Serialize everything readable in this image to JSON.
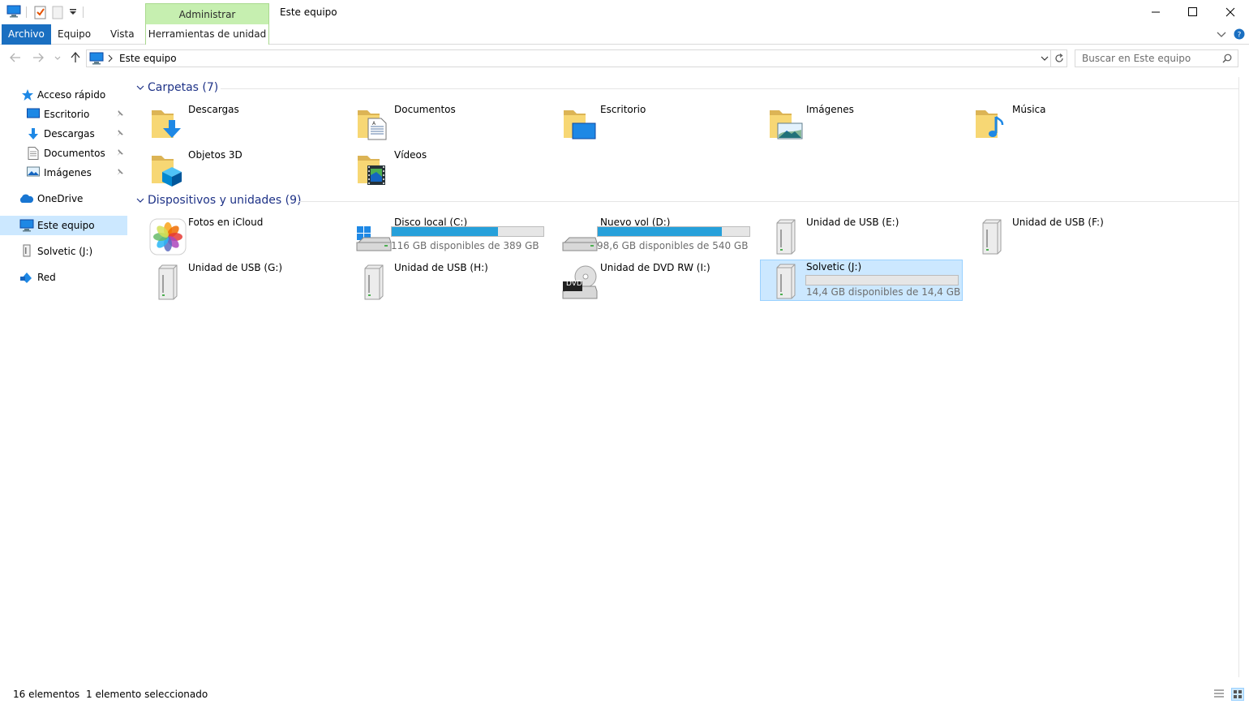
{
  "window": {
    "title": "Este equipo",
    "context_tab_group": "Administrar"
  },
  "ribbon": {
    "tabs": [
      {
        "label": "Archivo"
      },
      {
        "label": "Equipo"
      },
      {
        "label": "Vista"
      },
      {
        "label": "Herramientas de unidad"
      }
    ]
  },
  "address": {
    "path": "Este equipo",
    "search_placeholder": "Buscar en Este equipo"
  },
  "nav": {
    "quick_access": "Acceso rápido",
    "items": [
      {
        "label": "Escritorio",
        "pinned": true
      },
      {
        "label": "Descargas",
        "pinned": true
      },
      {
        "label": "Documentos",
        "pinned": true
      },
      {
        "label": "Imágenes",
        "pinned": true
      }
    ],
    "onedrive": "OneDrive",
    "this_pc": "Este equipo",
    "solvetic": "Solvetic (J:)",
    "network": "Red"
  },
  "folders": {
    "header": "Carpetas (7)",
    "items": [
      {
        "name": "Descargas",
        "icon": "downloads-folder-icon"
      },
      {
        "name": "Documentos",
        "icon": "documents-folder-icon"
      },
      {
        "name": "Escritorio",
        "icon": "desktop-folder-icon"
      },
      {
        "name": "Imágenes",
        "icon": "pictures-folder-icon"
      },
      {
        "name": "Música",
        "icon": "music-folder-icon"
      },
      {
        "name": "Objetos 3D",
        "icon": "3d-objects-folder-icon"
      },
      {
        "name": "Vídeos",
        "icon": "videos-folder-icon"
      }
    ]
  },
  "devices": {
    "header": "Dispositivos y unidades (9)",
    "items": [
      {
        "name": "Fotos en iCloud",
        "icon": "icloud-photos-icon"
      },
      {
        "name": "Disco local (C:)",
        "free": "116 GB disponibles de 389 GB",
        "used_fraction": 0.7,
        "icon": "windows-drive-icon"
      },
      {
        "name": "Nuevo vol (D:)",
        "free": "98,6 GB disponibles de 540 GB",
        "used_fraction": 0.82,
        "icon": "hard-drive-icon"
      },
      {
        "name": "Unidad de USB (E:)",
        "icon": "usb-drive-icon"
      },
      {
        "name": "Unidad de USB (F:)",
        "icon": "usb-drive-icon"
      },
      {
        "name": "Unidad de USB (G:)",
        "icon": "usb-drive-icon"
      },
      {
        "name": "Unidad de USB (H:)",
        "icon": "usb-drive-icon"
      },
      {
        "name": "Unidad de DVD RW (I:)",
        "icon": "dvd-drive-icon",
        "badge": "DVD"
      },
      {
        "name": "Solvetic (J:)",
        "free": "14,4 GB disponibles de 14,4 GB",
        "used_fraction": 0.0,
        "icon": "usb-drive-icon",
        "selected": true
      }
    ]
  },
  "status": {
    "count": "16 elementos",
    "selection": "1 elemento seleccionado"
  },
  "colors": {
    "accent": "#1a6fc1",
    "context_tab": "#c6efb0",
    "selection": "#cce8ff",
    "bar_fill": "#26a0da",
    "group_header": "#1e3287"
  }
}
